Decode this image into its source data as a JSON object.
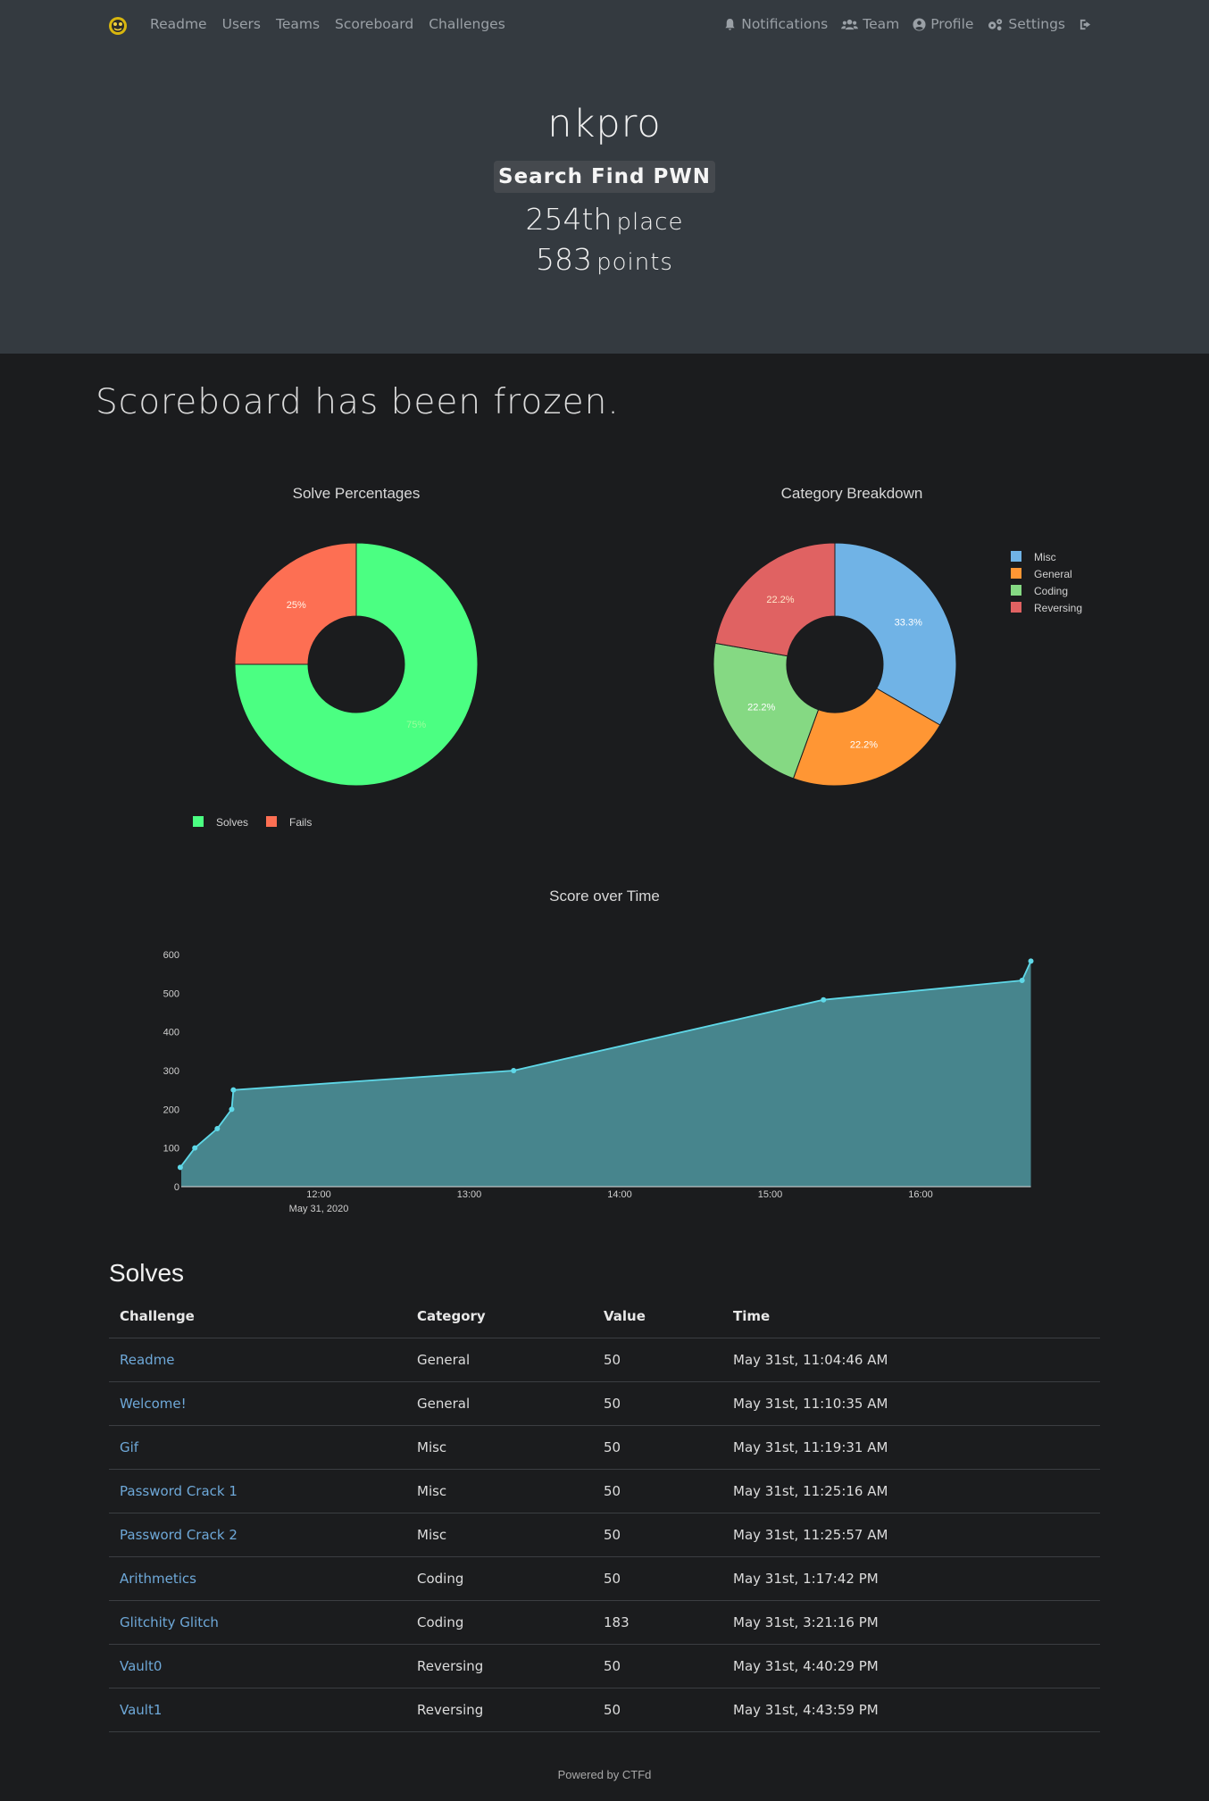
{
  "nav": {
    "left": [
      "Readme",
      "Users",
      "Teams",
      "Scoreboard",
      "Challenges"
    ],
    "right": [
      {
        "label": "Notifications",
        "icon": "bell-icon"
      },
      {
        "label": "Team",
        "icon": "users-icon"
      },
      {
        "label": "Profile",
        "icon": "user-circle-icon"
      },
      {
        "label": "Settings",
        "icon": "gears-icon"
      },
      {
        "label": "",
        "icon": "sign-out-icon"
      }
    ]
  },
  "profile": {
    "name": "nkpro",
    "team": "Search Find PWN",
    "place_num": "254th",
    "place_word": "place",
    "points_num": "583",
    "points_word": "points"
  },
  "notice": "Scoreboard has been frozen.",
  "chart_data": [
    {
      "type": "pie",
      "title": "Solve Percentages",
      "labels": [
        "Solves",
        "Fails"
      ],
      "values": [
        75,
        25
      ],
      "slice_labels": [
        "75%",
        "25%"
      ],
      "colors": [
        "#4bff82",
        "#fd6f53"
      ],
      "legend": "bottom"
    },
    {
      "type": "pie",
      "title": "Category Breakdown",
      "labels": [
        "Misc",
        "General",
        "Coding",
        "Reversing"
      ],
      "values": [
        33.3,
        22.2,
        22.2,
        22.2
      ],
      "slice_labels": [
        "33.3%",
        "22.2%",
        "22.2%",
        "22.2%"
      ],
      "colors": [
        "#70b3e6",
        "#ff9634",
        "#85d983",
        "#e06262"
      ],
      "legend": "right"
    },
    {
      "type": "area",
      "title": "Score over Time",
      "x_ticks": [
        "12:00",
        "13:00",
        "14:00",
        "15:00",
        "16:00"
      ],
      "x_tick_sub": "May 31, 2020",
      "y_ticks": [
        0,
        100,
        200,
        300,
        400,
        500,
        600
      ],
      "ylim": [
        0,
        600
      ],
      "series": [
        {
          "x": [
            "11:04:46",
            "11:10:35",
            "11:19:31",
            "11:25:16",
            "11:25:57",
            "13:17:42",
            "15:21:16",
            "16:40:29",
            "16:43:59"
          ],
          "y": [
            50,
            100,
            150,
            200,
            250,
            300,
            483,
            533,
            583
          ]
        }
      ],
      "line_color": "#5fd8e8",
      "fill_color": "#47858d"
    }
  ],
  "solves": {
    "title": "Solves",
    "headers": [
      "Challenge",
      "Category",
      "Value",
      "Time"
    ],
    "rows": [
      [
        "Readme",
        "General",
        "50",
        "May 31st, 11:04:46 AM"
      ],
      [
        "Welcome!",
        "General",
        "50",
        "May 31st, 11:10:35 AM"
      ],
      [
        "Gif",
        "Misc",
        "50",
        "May 31st, 11:19:31 AM"
      ],
      [
        "Password Crack 1",
        "Misc",
        "50",
        "May 31st, 11:25:16 AM"
      ],
      [
        "Password Crack 2",
        "Misc",
        "50",
        "May 31st, 11:25:57 AM"
      ],
      [
        "Arithmetics",
        "Coding",
        "50",
        "May 31st, 1:17:42 PM"
      ],
      [
        "Glitchity Glitch",
        "Coding",
        "183",
        "May 31st, 3:21:16 PM"
      ],
      [
        "Vault0",
        "Reversing",
        "50",
        "May 31st, 4:40:29 PM"
      ],
      [
        "Vault1",
        "Reversing",
        "50",
        "May 31st, 4:43:59 PM"
      ]
    ]
  },
  "footer": "Powered by CTFd"
}
